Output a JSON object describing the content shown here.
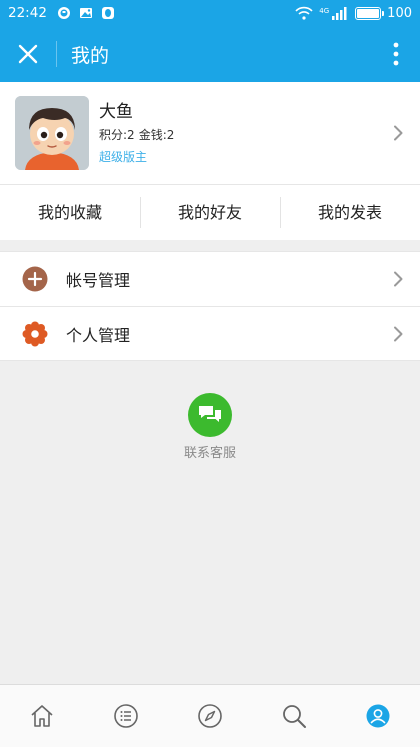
{
  "status_bar": {
    "time": "22:42",
    "network": "4G",
    "battery_level": "100",
    "icons": [
      "whatsapp-icon",
      "photo-icon",
      "qq-icon",
      "wifi-icon",
      "signal-icon",
      "battery-icon"
    ]
  },
  "header": {
    "title": "我的",
    "close_icon": "close-icon",
    "more_icon": "more-vertical-icon"
  },
  "profile": {
    "username": "大鱼",
    "points_label": "积分:2",
    "money_label": "金钱:2",
    "role": "超级版主"
  },
  "quick_links": [
    {
      "label": "我的收藏"
    },
    {
      "label": "我的好友"
    },
    {
      "label": "我的发表"
    }
  ],
  "menu": [
    {
      "label": "帐号管理",
      "icon": "plus-circle-icon"
    },
    {
      "label": "个人管理",
      "icon": "gear-icon"
    }
  ],
  "service": {
    "label": "联系客服"
  },
  "bottom_nav": [
    {
      "icon": "home-icon"
    },
    {
      "icon": "list-icon"
    },
    {
      "icon": "compass-icon"
    },
    {
      "icon": "search-icon"
    },
    {
      "icon": "user-icon",
      "active": true
    }
  ],
  "colors": {
    "primary": "#1ba5e6",
    "accent_text": "#3fb0e8",
    "service_green": "#3cba2e",
    "account_icon": "#a4654a",
    "settings_icon": "#de5a24"
  }
}
